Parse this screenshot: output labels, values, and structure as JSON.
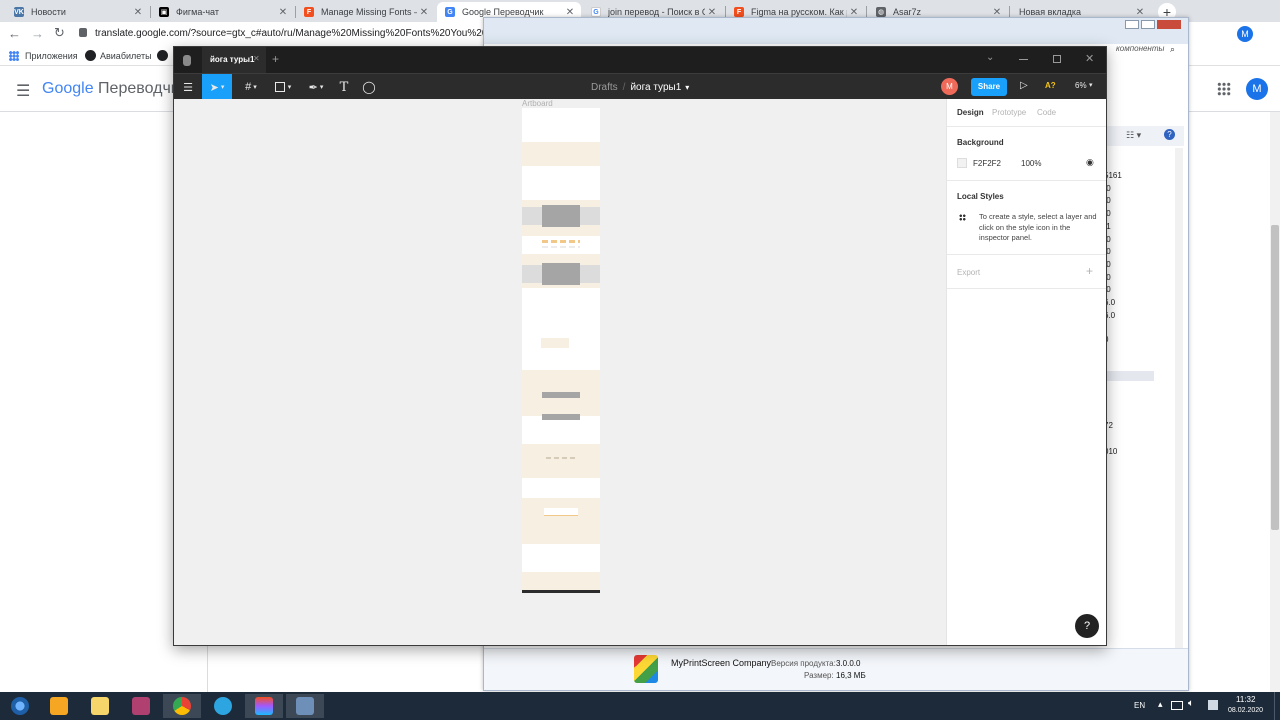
{
  "browser": {
    "tabs": [
      {
        "label": "Новости",
        "color": "#4a76a8",
        "glyph": "VK",
        "active": false
      },
      {
        "label": "Фигма-чат",
        "color": "#000000",
        "glyph": "▣",
        "active": false
      },
      {
        "label": "Manage Missing Fonts – Fig",
        "color": "#f24e1e",
        "glyph": "F",
        "active": false
      },
      {
        "label": "Google Переводчик",
        "color": "#4285f4",
        "glyph": "G",
        "active": true
      },
      {
        "label": "join перевод - Поиск в Goo",
        "color": "#ffffff",
        "glyph": "G",
        "active": false
      },
      {
        "label": "Figma на русском. Как русс",
        "color": "#f24e1e",
        "glyph": "F",
        "active": false
      },
      {
        "label": "Asar7z",
        "color": "#5f6368",
        "glyph": "◍",
        "active": false
      },
      {
        "label": "Новая вкладка",
        "color": "#dee1e6",
        "glyph": "",
        "active": false
      }
    ],
    "new_tab": "+",
    "url": "translate.google.com/?source=gtx_c#auto/ru/Manage%20Missing%20Fonts%20You%20have%",
    "bookmarks": [
      {
        "label": "Приложения",
        "icon": "apps-grid-icon"
      },
      {
        "label": "Авиабилеты",
        "icon": "plane-icon"
      }
    ],
    "avatar_letter": "M"
  },
  "translate": {
    "logo": "Google",
    "product": "Переводчик",
    "avatar_letter": "M"
  },
  "bg_window": {
    "title_fragment": "компоненты",
    "side_values": [
      "5161",
      ".0",
      ".0",
      ".0",
      ".1",
      ".0",
      ".0",
      ".0",
      ".0",
      ".0",
      "6.0",
      "6.0",
      "0",
      "72",
      "010"
    ],
    "company": "MyPrintScreen Company",
    "version_label": "Версия продукта:",
    "version_value": "3.0.0.0",
    "size_label": "Размер:",
    "size_value": "16,3 МБ"
  },
  "figma": {
    "file_tab": "йога туры1",
    "add_tab": "+",
    "breadcrumb_root": "Drafts",
    "breadcrumb_sep": "/",
    "file_name": "йога туры1",
    "avatar_letter": "M",
    "share_label": "Share",
    "missing_fonts_label": "A?",
    "zoom": "6%",
    "artboard_label": "Artboard",
    "panel": {
      "tabs": [
        "Design",
        "Prototype",
        "Code"
      ],
      "background_heading": "Background",
      "bg_hex": "F2F2F2",
      "bg_opacity": "100%",
      "local_styles_heading": "Local Styles",
      "local_styles_hint": "To create a style, select a layer and click on the style icon in the inspector panel.",
      "export_heading": "Export",
      "export_add": "+"
    },
    "help_label": "?"
  },
  "taskbar": {
    "lang": "EN",
    "time": "11:32",
    "date": "08.02.2020"
  },
  "colors": {
    "figma_blue": "#18a0fb",
    "figma_dark": "#2c2c2c",
    "artboard_beige": "#f7efe1",
    "block_gray": "#a5a5a5",
    "avatar_red": "#f06a5a"
  }
}
